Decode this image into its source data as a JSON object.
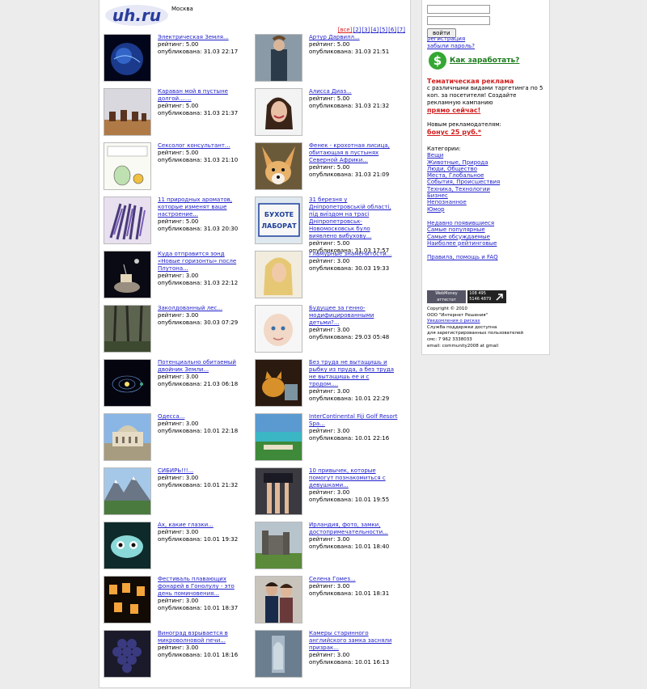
{
  "logo": "uh.ru",
  "city": "Москва",
  "pager": [
    "[все]",
    "[2]",
    "[3]",
    "[4]",
    "[5]",
    "[6]",
    "[7]"
  ],
  "rating_label": "рейтинг:",
  "published_label": "опубликована:",
  "articles": [
    {
      "title": "Электрическая Земля...",
      "rating": "5.00",
      "date": "31.03 22:17",
      "thumb": "earth"
    },
    {
      "title": "Артур Дарвилл...",
      "rating": "5.00",
      "date": "31.03 21:51",
      "thumb": "man"
    },
    {
      "title": "Караван мой в пустыне долгой.......",
      "rating": "5.00",
      "date": "31.03 21:37",
      "thumb": "desert"
    },
    {
      "title": "Алисса Диаз...",
      "rating": "5.00",
      "date": "31.03 21:32",
      "thumb": "woman"
    },
    {
      "title": "Сексолог консультант...",
      "rating": "5.00",
      "date": "31.03 21:10",
      "thumb": "cartoon"
    },
    {
      "title": "Фенек - крохотная лисица, обитающая в пустынях Северной Африки...",
      "rating": "5.00",
      "date": "31.03 21:09",
      "thumb": "fox"
    },
    {
      "title": "11 природных ароматов, которые изменят ваше настроение...",
      "rating": "5.00",
      "date": "31.03 20:30",
      "thumb": "lavender"
    },
    {
      "title": "31 березня у Дніпропетровській області, під виїздом на трасі Дніпропетровськ-Новомосковськ було виявлено вибухову...",
      "rating": "5.00",
      "date": "31.03 17:57",
      "thumb": "sign"
    },
    {
      "title": "Куда отправится зонд «Новые горизонты» после Плутона...",
      "rating": "3.00",
      "date": "31.03 22:12",
      "thumb": "probe"
    },
    {
      "title": "Гламурные знаменитости...",
      "rating": "3.00",
      "date": "30.03 19:33",
      "thumb": "blonde"
    },
    {
      "title": "Заколдованный лес...",
      "rating": "3.00",
      "date": "30.03 07:29",
      "thumb": "forest"
    },
    {
      "title": "Будущее за генно-модифицированными детьми?...",
      "rating": "3.00",
      "date": "29.03 05:48",
      "thumb": "baby"
    },
    {
      "title": "Потенциально обитаемый двойник Земли...",
      "rating": "3.00",
      "date": "21.03 06:18",
      "thumb": "orbit"
    },
    {
      "title": "Без труда не вытащишь и рыбку из пруда, а без труда не вытащишь ее и с тродом....",
      "rating": "3.00",
      "date": "10.01 22:29",
      "thumb": "cat"
    },
    {
      "title": "Одесса...",
      "rating": "3.00",
      "date": "10.01 22:18",
      "thumb": "odessa"
    },
    {
      "title": "InterContinental Fiji Golf Resort Spa...",
      "rating": "3.00",
      "date": "10.01 22:16",
      "thumb": "resort"
    },
    {
      "title": "СИБИРЬ!!!...",
      "rating": "3.00",
      "date": "10.01 21:32",
      "thumb": "mountains"
    },
    {
      "title": "10 привычек, которые помогут познакомиться с девушками...",
      "rating": "3.00",
      "date": "10.01 19:55",
      "thumb": "legs"
    },
    {
      "title": "Ах, какие глазки...",
      "rating": "3.00",
      "date": "10.01 19:32",
      "thumb": "eyes"
    },
    {
      "title": "Ирландия, фото, замки, достопримечательности...",
      "rating": "3.00",
      "date": "10.01 18:40",
      "thumb": "castle"
    },
    {
      "title": "Фестиваль плавающих фонарей в Гонолулу - это день поминовения...",
      "rating": "3.00",
      "date": "10.01 18:37",
      "thumb": "lanterns"
    },
    {
      "title": "Селена Гомез...",
      "rating": "3.00",
      "date": "10.01 18:31",
      "thumb": "couple"
    },
    {
      "title": "Виноград взрывается в микроволновой печи...",
      "rating": "3.00",
      "date": "10.01 18:16",
      "thumb": "grapes"
    },
    {
      "title": "Камеры старинного английского замка засняли призрак...",
      "rating": "3.00",
      "date": "10.01 16:13",
      "thumb": "ghost"
    }
  ],
  "sidebar": {
    "login_button": "войти",
    "register_link": "регистрация",
    "forgot_link": "забыли пароль?",
    "earn_link": "Как заработать?",
    "promo_title": "Тематическая реклама",
    "promo_text": "с различными видами таргетинга по 5 коп. за посетителя! Создайте рекламную кампанию",
    "promo_cta": "прямо сейчас!",
    "new_adv_text": "Новым рекламодателям:",
    "bonus": "бонус 25 руб.*",
    "categories_label": "Категории:",
    "categories": [
      "Вещи",
      "Животные, Природа",
      "Люди, Общество",
      "Места, Глобальное",
      "События, Происшествия",
      "Техника, Технологии",
      "Бизнес",
      "Непознанное",
      "Юмор"
    ],
    "more_links": [
      "Недавно появившиеся",
      "Самые популярные",
      "Самые обсуждаемые",
      "Наиболее рейтинговые"
    ],
    "help_link": "Правила, помощь и FAQ",
    "badge_wm_top": "WebMoney",
    "badge_wm_bottom": "аттестат участника",
    "badge_counter": "108 495 5146 4879",
    "copyright": "Copyright © 2010",
    "company": "ООО \"Интернет Решения\"",
    "notice_link": "Уведомления о рисках",
    "support1": "Служба поддержки доступна",
    "support2": "для зарегистрированных пользователей",
    "sms": "смс: 7 962 3338033",
    "email": "email: community2008 at gmail"
  }
}
